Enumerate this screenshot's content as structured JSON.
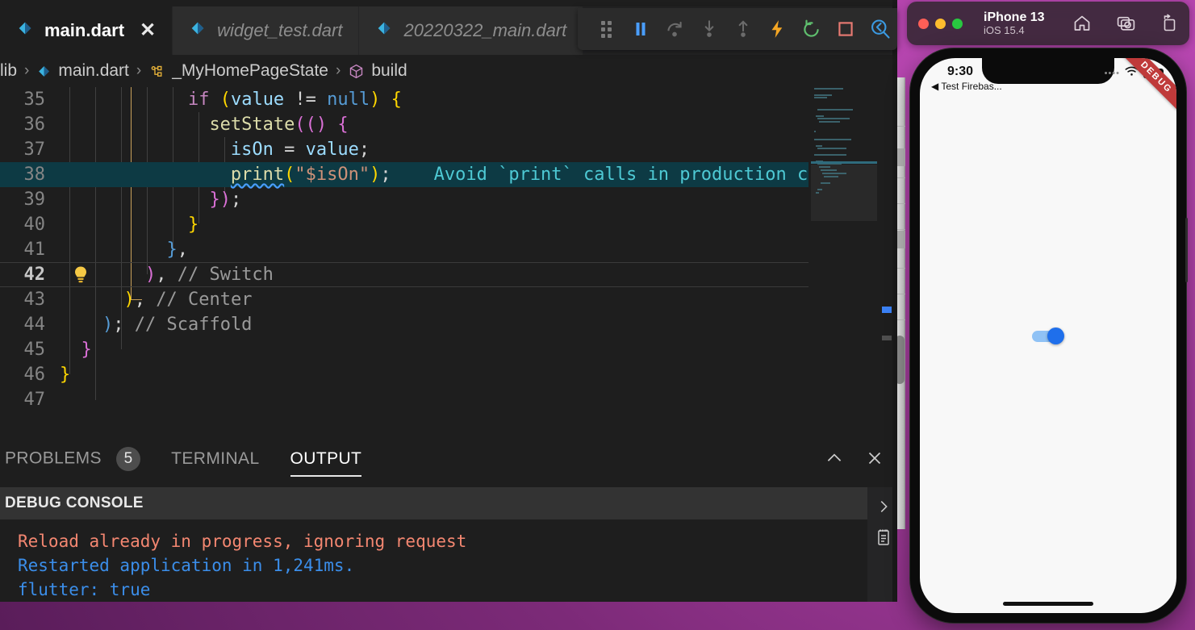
{
  "editor": {
    "tabs": [
      {
        "label": "main.dart",
        "icon": "dart-icon",
        "active": true,
        "closable": true
      },
      {
        "label": "widget_test.dart",
        "icon": "dart-icon",
        "active": false,
        "closable": false
      },
      {
        "label": "20220322_main.dart",
        "icon": "dart-icon",
        "active": false,
        "closable": false
      }
    ],
    "breadcrumb": [
      {
        "label": "lib",
        "icon": "folder-icon"
      },
      {
        "label": "main.dart",
        "icon": "dart-icon"
      },
      {
        "label": "_MyHomePageState",
        "icon": "class-icon"
      },
      {
        "label": "build",
        "icon": "method-icon"
      }
    ],
    "breadcrumb_separator": "›",
    "code_lines": [
      {
        "num": "35",
        "tokens": [
          {
            "t": "            ",
            "c": "k-plain"
          },
          {
            "t": "if",
            "c": "k-key"
          },
          {
            "t": " ",
            "c": "k-plain"
          },
          {
            "t": "(",
            "c": "k-p1"
          },
          {
            "t": "value",
            "c": "k-var"
          },
          {
            "t": " != ",
            "c": "k-plain"
          },
          {
            "t": "null",
            "c": "k-p3"
          },
          {
            "t": ")",
            "c": "k-p1"
          },
          {
            "t": " ",
            "c": "k-plain"
          },
          {
            "t": "{",
            "c": "k-p1"
          }
        ]
      },
      {
        "num": "36",
        "tokens": [
          {
            "t": "              ",
            "c": "k-plain"
          },
          {
            "t": "setState",
            "c": "k-fn"
          },
          {
            "t": "((",
            "c": "k-p2"
          },
          {
            "t": ")",
            "c": "k-p2"
          },
          {
            "t": " ",
            "c": "k-plain"
          },
          {
            "t": "{",
            "c": "k-p2"
          }
        ]
      },
      {
        "num": "37",
        "tokens": [
          {
            "t": "                ",
            "c": "k-plain"
          },
          {
            "t": "isOn",
            "c": "k-var"
          },
          {
            "t": " = ",
            "c": "k-plain"
          },
          {
            "t": "value",
            "c": "k-var"
          },
          {
            "t": ";",
            "c": "k-plain"
          }
        ]
      },
      {
        "num": "38",
        "highlight": true,
        "tokens": [
          {
            "t": "                ",
            "c": "k-plain"
          },
          {
            "t": "print",
            "c": "k-fn squiggle"
          },
          {
            "t": "(",
            "c": "k-p1"
          },
          {
            "t": "\"$isOn\"",
            "c": "k-str"
          },
          {
            "t": ")",
            "c": "k-p1"
          },
          {
            "t": ";",
            "c": "k-plain"
          },
          {
            "t": "    ",
            "c": "k-plain"
          },
          {
            "t": "Avoid `print` calls in production code.",
            "c": "k-hint"
          }
        ]
      },
      {
        "num": "39",
        "tokens": [
          {
            "t": "              ",
            "c": "k-plain"
          },
          {
            "t": "}",
            "c": "k-p2"
          },
          {
            "t": ")",
            "c": "k-p2"
          },
          {
            "t": ";",
            "c": "k-plain"
          }
        ]
      },
      {
        "num": "40",
        "tokens": [
          {
            "t": "            ",
            "c": "k-plain"
          },
          {
            "t": "}",
            "c": "k-p1"
          }
        ]
      },
      {
        "num": "41",
        "tokens": [
          {
            "t": "          ",
            "c": "k-plain"
          },
          {
            "t": "}",
            "c": "k-p3"
          },
          {
            "t": ",",
            "c": "k-plain"
          }
        ]
      },
      {
        "num": "42",
        "cursorline": true,
        "bulb": true,
        "tokens": [
          {
            "t": "        ",
            "c": "k-plain"
          },
          {
            "t": ")",
            "c": "k-p2"
          },
          {
            "t": ",",
            "c": "k-plain"
          },
          {
            "t": " ",
            "c": "k-plain"
          },
          {
            "t": "// Switch",
            "c": "k-cmt"
          }
        ]
      },
      {
        "num": "43",
        "tokens": [
          {
            "t": "      ",
            "c": "k-plain"
          },
          {
            "t": ")",
            "c": "k-p1"
          },
          {
            "t": ",",
            "c": "k-plain"
          },
          {
            "t": " ",
            "c": "k-plain"
          },
          {
            "t": "// Center",
            "c": "k-cmt"
          }
        ]
      },
      {
        "num": "44",
        "tokens": [
          {
            "t": "    ",
            "c": "k-plain"
          },
          {
            "t": ")",
            "c": "k-p3"
          },
          {
            "t": ";",
            "c": "k-plain"
          },
          {
            "t": " ",
            "c": "k-plain"
          },
          {
            "t": "// Scaffold",
            "c": "k-cmt"
          }
        ]
      },
      {
        "num": "45",
        "tokens": [
          {
            "t": "  ",
            "c": "k-plain"
          },
          {
            "t": "}",
            "c": "k-p2"
          }
        ]
      },
      {
        "num": "46",
        "tokens": [
          {
            "t": "",
            "c": "k-plain"
          },
          {
            "t": "}",
            "c": "k-p1"
          }
        ]
      },
      {
        "num": "47",
        "tokens": []
      }
    ]
  },
  "debug_toolbar": {
    "buttons": [
      {
        "name": "drag-handle-icon",
        "title": "Drag"
      },
      {
        "name": "pause-icon",
        "title": "Pause",
        "color": "#4a9eff"
      },
      {
        "name": "step-over-icon",
        "title": "Step Over",
        "color": "#6b6b6b"
      },
      {
        "name": "step-into-icon",
        "title": "Step Into",
        "color": "#6b6b6b"
      },
      {
        "name": "step-out-icon",
        "title": "Step Out",
        "color": "#6b6b6b"
      },
      {
        "name": "hot-reload-icon",
        "title": "Hot Reload",
        "color": "#f5a623"
      },
      {
        "name": "hot-restart-icon",
        "title": "Hot Restart",
        "color": "#5fbf6e"
      },
      {
        "name": "stop-icon",
        "title": "Stop",
        "color": "#e87a72"
      },
      {
        "name": "flutter-inspector-icon",
        "title": "Open DevTools",
        "color": "#3b9ae1"
      }
    ]
  },
  "panel": {
    "tabs": [
      {
        "label": "PROBLEMS",
        "badge": "5",
        "active": false
      },
      {
        "label": "TERMINAL",
        "badge": null,
        "active": false
      },
      {
        "label": "OUTPUT",
        "badge": null,
        "active": true
      }
    ],
    "actions": [
      {
        "name": "maximize-panel-icon",
        "glyph": "∧"
      },
      {
        "name": "close-panel-icon",
        "glyph": "✕"
      }
    ],
    "console_title": "DEBUG CONSOLE",
    "side_actions": [
      {
        "name": "expand-console-icon",
        "glyph": "›"
      },
      {
        "name": "clear-console-icon",
        "glyph": "clipboard"
      }
    ],
    "console_lines": [
      {
        "text": "Reload already in progress, ignoring request",
        "kind": "err"
      },
      {
        "text": "Restarted application in 1,241ms.",
        "kind": "info"
      },
      {
        "text": "flutter: true",
        "kind": "info"
      }
    ]
  },
  "simulator": {
    "window_title": "iPhone 13",
    "window_subtitle": "iOS 15.4",
    "traffic_lights": [
      "close-button",
      "minimize-button",
      "maximize-button"
    ],
    "toolbar_icons": [
      {
        "name": "home-icon"
      },
      {
        "name": "screenshot-icon"
      },
      {
        "name": "rotate-icon"
      }
    ],
    "status_bar": {
      "time": "9:30",
      "back_label": "◀ Test Firebas...",
      "signal_dots": "••••",
      "debug_banner": "DEBUG"
    },
    "app": {
      "switch_state": "on",
      "switch_track_color": "#90c2f5",
      "switch_thumb_color": "#1f6feb"
    }
  },
  "colors": {
    "editor_bg": "#1e1e1e",
    "tab_inactive_bg": "#2d2d2d",
    "highlight_line": "#0d3a44",
    "accent": "#3b8eea",
    "error": "#f48771"
  }
}
